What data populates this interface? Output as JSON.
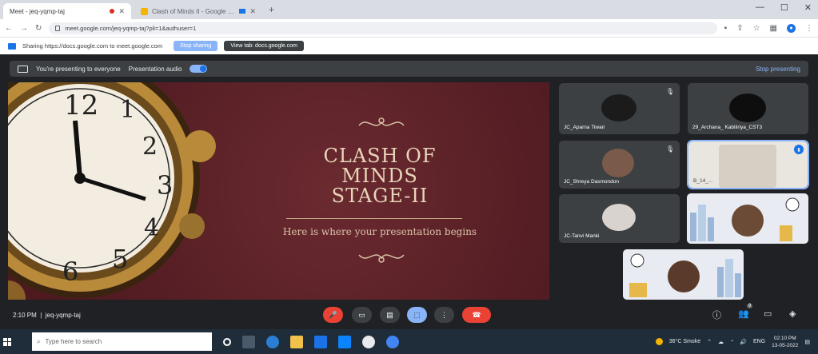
{
  "browser": {
    "tabs": [
      {
        "label": "Meet - jeq-yqmp-taj",
        "active": true
      },
      {
        "label": "Clash of Minds II - Google Slides",
        "active": false
      }
    ],
    "url": "meet.google.com/jeq-yqmp-taj?pli=1&authuser=1",
    "window_controls": [
      "—",
      "☐",
      "✕"
    ]
  },
  "sharebar": {
    "text": "Sharing https://docs.google.com to meet.google.com",
    "stop_label": "Stop sharing",
    "view_label": "View tab: docs.google.com"
  },
  "meet": {
    "presenting_text": "You're presenting to everyone",
    "audio_label": "Presentation audio",
    "stop_presenting": "Stop presenting",
    "slide": {
      "title_lines": [
        "CLASH OF",
        "MINDS",
        "STAGE-II"
      ],
      "subtitle": "Here is where your presentation begins",
      "clock_numbers": [
        "12",
        "1",
        "2",
        "3",
        "4",
        "5",
        "6"
      ]
    },
    "participants": [
      {
        "name": "JC_Aparna Tiwari"
      },
      {
        "name": "29_Archana_ Kabiliriya_CST3"
      },
      {
        "name": "JC_Shreya Dasmondon"
      },
      {
        "name": "B_14_..."
      },
      {
        "name": "JC-Tanvi Manki"
      },
      {
        "name": ""
      },
      {
        "name": ""
      }
    ],
    "time": "2:10 PM",
    "meeting_code": "jeq-yqmp-taj",
    "participant_badge": "9"
  },
  "taskbar": {
    "search_placeholder": "Type here to search",
    "weather": "36°C Smoke",
    "tray_lang": "ENG",
    "clock_time": "02:10 PM",
    "clock_date": "13-05-2022"
  },
  "colors": {
    "meet_bg": "#202124",
    "tile_bg": "#3c4043",
    "slide_bg": "#5a1f26",
    "accent_blue": "#8ab4f8",
    "end_call_red": "#ea4335"
  }
}
